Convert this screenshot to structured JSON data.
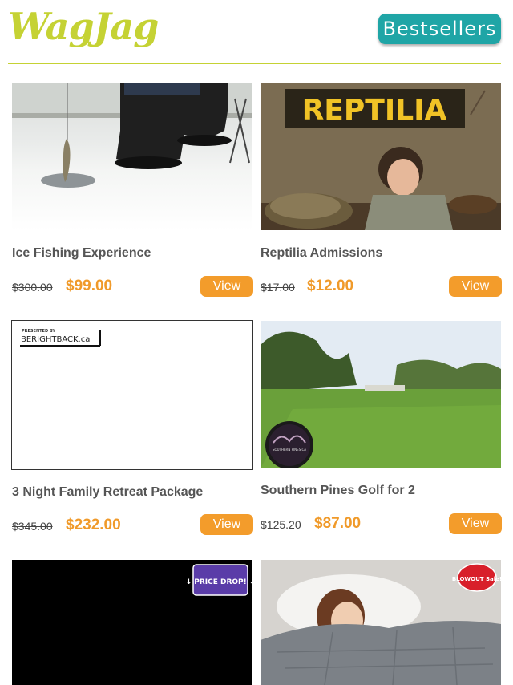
{
  "header": {
    "logo_text": "WagJag",
    "bestsellers_label": "Bestsellers"
  },
  "deals": [
    {
      "title": "Ice Fishing Experience",
      "old_price": "$300.00",
      "new_price": "$99.00",
      "view_label": "View"
    },
    {
      "title": "Reptilia Admissions",
      "old_price": "$17.00",
      "new_price": "$12.00",
      "view_label": "View",
      "image_text": "REPTILIA"
    },
    {
      "title": "3 Night Family Retreat Package",
      "old_price": "$345.00",
      "new_price": "$232.00",
      "view_label": "View",
      "image_badge_small": "PRESENTED BY",
      "image_badge": "BERIGHTBACK.ca"
    },
    {
      "title": "Southern Pines Golf for 2",
      "old_price": "$125.20",
      "new_price": "$87.00",
      "view_label": "View",
      "image_badge": "SOUTHERN PINES.CA"
    },
    {
      "image_badge": "↓ PRICE DROP! ↓"
    },
    {
      "image_badge": "BLOWOUT Sale!"
    }
  ],
  "colors": {
    "brand_lime": "#c5d234",
    "bestsellers_teal": "#1fa5a6",
    "view_orange": "#f39c2b",
    "price_orange": "#f09a2a"
  }
}
